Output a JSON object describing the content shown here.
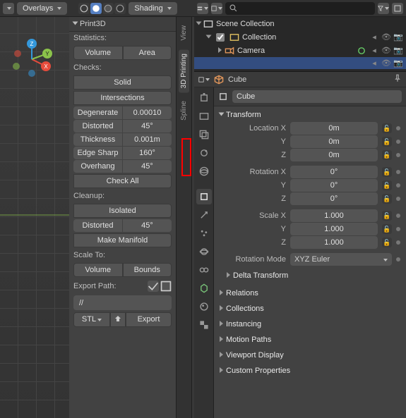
{
  "viewport_header": {
    "overlays_label": "Overlays",
    "shading_label": "Shading",
    "shading_modes": [
      "wireframe",
      "solid",
      "matpreview",
      "rendered"
    ],
    "active_shading_index": 1
  },
  "gizmo_axes": {
    "x": "X",
    "y": "Y",
    "z": "Z"
  },
  "n_panel": {
    "title": "Print3D",
    "statistics_label": "Statistics:",
    "volume_btn": "Volume",
    "area_btn": "Area",
    "checks_label": "Checks:",
    "solid_btn": "Solid",
    "intersections_btn": "Intersections",
    "check_rows": [
      {
        "name": "Degenerate",
        "value": "0.00010"
      },
      {
        "name": "Distorted",
        "value": "45°"
      },
      {
        "name": "Thickness",
        "value": "0.001m"
      },
      {
        "name": "Edge Sharp",
        "value": "160°"
      },
      {
        "name": "Overhang",
        "value": "45°"
      }
    ],
    "check_all_btn": "Check All",
    "cleanup_label": "Cleanup:",
    "isolated_btn": "Isolated",
    "cleanup_rows": [
      {
        "name": "Distorted",
        "value": "45°"
      }
    ],
    "make_manifold_btn": "Make Manifold",
    "scaleto_label": "Scale To:",
    "scaleto_volume": "Volume",
    "scaleto_bounds": "Bounds",
    "export_path_label": "Export Path:",
    "export_path_value": "//",
    "export_format": "STL",
    "export_btn": "Export"
  },
  "vert_tabs": [
    "View",
    "3D Printing",
    "Spline"
  ],
  "active_vert_tab": 1,
  "right_header": {
    "search_placeholder": ""
  },
  "outliner": {
    "scene_collection": "Scene Collection",
    "collection": "Collection",
    "items": [
      {
        "name": "Camera",
        "icon": "camera"
      }
    ]
  },
  "properties": {
    "breadcrumb_item": "Cube",
    "object_name": "Cube",
    "object_icon": "cube",
    "sections": {
      "transform": {
        "title": "Transform",
        "location_label": "Location X",
        "rotation_label": "Rotation X",
        "scale_label": "Scale X",
        "axis_y": "Y",
        "axis_z": "Z",
        "loc": [
          "0m",
          "0m",
          "0m"
        ],
        "rot": [
          "0°",
          "0°",
          "0°"
        ],
        "scl": [
          "1.000",
          "1.000",
          "1.000"
        ],
        "rot_mode_label": "Rotation Mode",
        "rot_mode_value": "XYZ Euler",
        "delta_title": "Delta Transform"
      },
      "closed": [
        "Relations",
        "Collections",
        "Instancing",
        "Motion Paths",
        "Viewport Display",
        "Custom Properties"
      ]
    }
  }
}
